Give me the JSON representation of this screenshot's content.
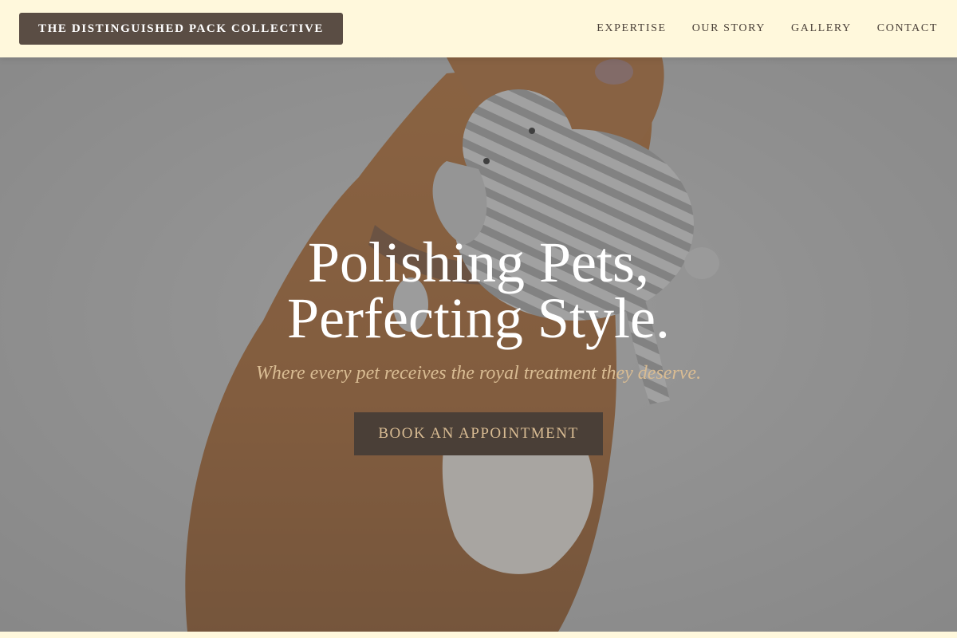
{
  "header": {
    "brand": "THE DISTINGUISHED PACK COLLECTIVE",
    "nav": [
      {
        "label": "EXPERTISE"
      },
      {
        "label": "OUR STORY"
      },
      {
        "label": "GALLERY"
      },
      {
        "label": "CONTACT"
      }
    ]
  },
  "hero": {
    "title_line1": "Polishing Pets,",
    "title_line2": "Perfecting Style.",
    "subtitle": "Where every pet receives the royal treatment they deserve.",
    "cta_label": "BOOK AN APPOINTMENT",
    "image": {
      "subject": "dog-with-elephant-plush-photo"
    }
  },
  "colors": {
    "header_bg": "#fff8dc",
    "brand_bg": "#5a4d44",
    "nav_text": "#4a4038",
    "accent_gold": "#d9bc93",
    "cta_bg": "#4a3f37"
  }
}
